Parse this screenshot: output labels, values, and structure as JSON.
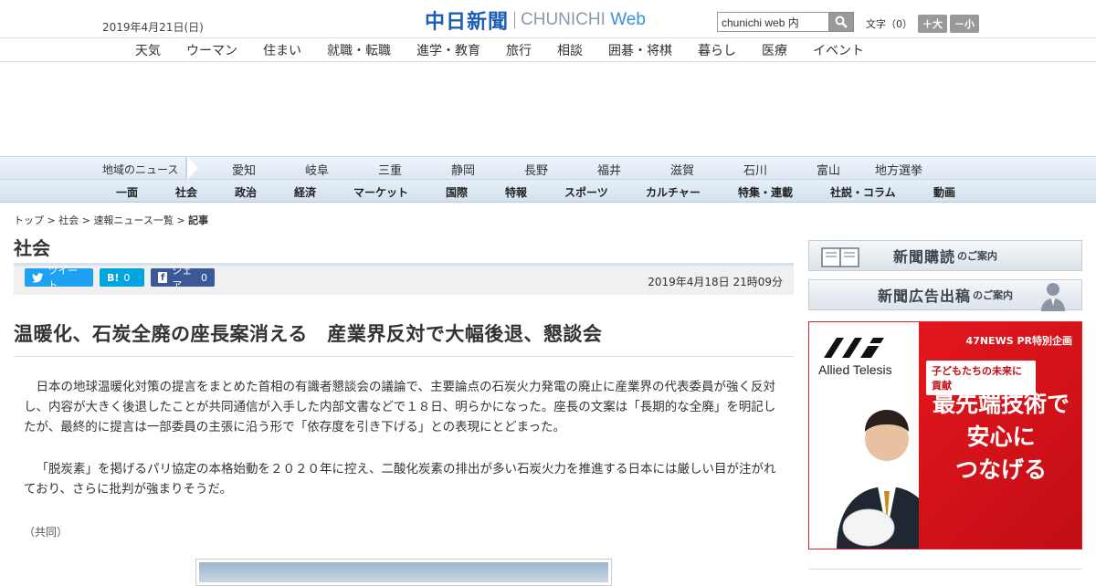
{
  "header": {
    "date": "2019年4月21日(日)",
    "logo_jp": "中日新聞",
    "logo_en_left": "CHUNICHI",
    "logo_en_right": "Web",
    "search_value": "chunichi web 内",
    "fontsize_label": "文字（0）",
    "fontsize_plus": "＋大",
    "fontsize_minus": "－小"
  },
  "category_nav": [
    "天気",
    "ウーマン",
    "住まい",
    "就職・転職",
    "進学・教育",
    "旅行",
    "相談",
    "囲碁・将棋",
    "暮らし",
    "医療",
    "イベント"
  ],
  "region_nav": {
    "label": "地域のニュース",
    "items": [
      "愛知",
      "岐阜",
      "三重",
      "静岡",
      "長野",
      "福井",
      "滋賀",
      "石川",
      "富山",
      "地方選挙"
    ]
  },
  "section_nav": [
    "一面",
    "社会",
    "政治",
    "経済",
    "マーケット",
    "国際",
    "特報",
    "スポーツ",
    "カルチャー",
    "特集・連載",
    "社説・コラム",
    "動画"
  ],
  "breadcrumb": [
    "トップ",
    "社会",
    "速報ニュース一覧",
    "記事"
  ],
  "article": {
    "category": "社会",
    "share": {
      "tweet": "ツイート",
      "hatena_label": "B!",
      "hatena_count": "0",
      "fb_label": "シェア",
      "fb_count": "0"
    },
    "published": "2019年4月18日 21時09分",
    "headline": "温暖化、石炭全廃の座長案消える　産業界反対で大幅後退、懇談会",
    "paragraphs": [
      "日本の地球温暖化対策の提言をまとめた首相の有識者懇談会の議論で、主要論点の石炭火力発電の廃止に産業界の代表委員が強く反対し、内容が大きく後退したことが共同通信が入手した内部文書などで１８日、明らかになった。座長の文案は「長期的な全廃」を明記したが、最終的に提言は一部委員の主張に沿う形で「依存度を引き下げる」との表現にとどまった。",
      "「脱炭素」を掲げるパリ協定の本格始動を２０２０年に控え、二酸化炭素の排出が多い石炭火力を推進する日本には厳しい目が注がれており、さらに批判が強まりそうだ。"
    ],
    "credit": "（共同）"
  },
  "sidebar": {
    "subscribe_big": "新聞購読",
    "subscribe_small": "のご案内",
    "adpost_big": "新聞広告出稿",
    "adpost_small": "のご案内",
    "ad": {
      "promo": "47NEWS PR特別企画",
      "tag": "子どもたちの未来に貢献",
      "catch": [
        "最先端技術で",
        "安心に",
        "つなげる"
      ],
      "brand": "Allied Telesis"
    }
  }
}
